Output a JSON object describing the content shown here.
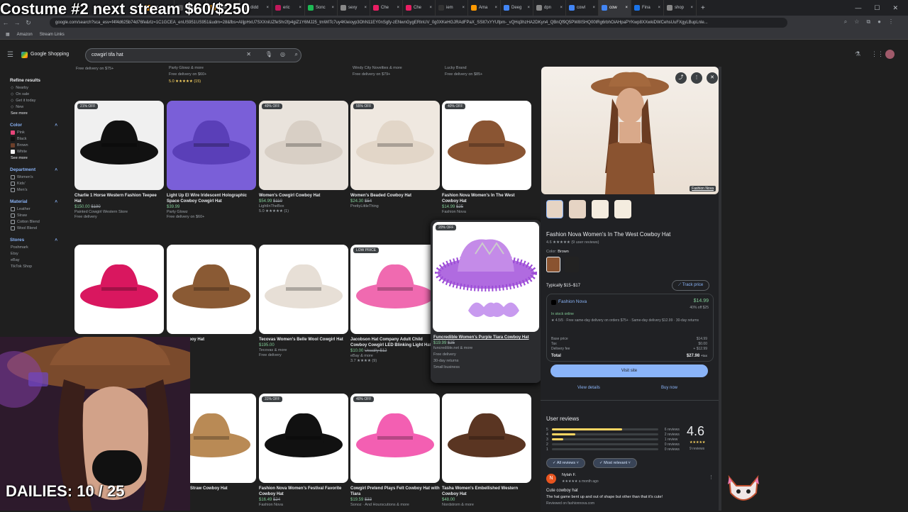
{
  "overlay": {
    "title": "Costume #2 next stream $60/$250",
    "dailies": "DAILIES: 10 / 25"
  },
  "browser": {
    "tabs": [
      "Ama",
      "didd",
      "Ama",
      "didd",
      "eric",
      "Sonc",
      "sexy",
      "Che",
      "Che",
      "iem",
      "Ama",
      "Deeg",
      "dpn",
      "cowl",
      "cow",
      "Fina",
      "shop"
    ],
    "active_tab": "cow",
    "url": "google.com/search?sca_esv=f4f4d625b74d76fe&rlz=1C1GCEA_enUS951US951&udm=28&fbs=AIljpHxU7SXXniUZfeShr2fp4giZ1Y6MJ25_tmWITc7uy4KIeioyp3OhN11EY0nSgfy-zENwnGygERInUV_0g0XKeHGJRAdFPaX_SSIt7xYYUfpm-_vQHq3hzHA2DKyn4_QBnQf9Q5PW8ISHQ00tRg6rbhOiAHpaPYKwp8XXwkiDWCehsUuFXgyLBupLnle...",
    "bookmarks": [
      "Amazon",
      "Stream Links"
    ]
  },
  "google": {
    "brand": "Google Shopping",
    "query": "cowgirl tifa hat"
  },
  "sidebar": {
    "refine": "Refine results",
    "refine_items": [
      "Nearby",
      "On sale",
      "Get it today",
      "New"
    ],
    "see_more": "See more",
    "color_h": "Color",
    "colors": [
      {
        "name": "Pink",
        "hex": "#e8457a"
      },
      {
        "name": "Black",
        "hex": "#111111"
      },
      {
        "name": "Brown",
        "hex": "#6b3f2a"
      },
      {
        "name": "White",
        "hex": "#f2f2f2"
      }
    ],
    "dept_h": "Department",
    "depts": [
      "Women's",
      "Kids'",
      "Men's"
    ],
    "material_h": "Material",
    "materials": [
      "Leather",
      "Straw",
      "Cotton Blend",
      "Wool Blend"
    ],
    "stores_h": "Stores",
    "stores": [
      "Poshmark",
      "Etsy",
      "eBay",
      "TikTok Shop"
    ]
  },
  "top_partial": [
    "Free delivery on $75+",
    "Party Glowz & more",
    "Free delivery on $60+",
    "5.0 ★★★★★ (15)",
    "Windy City Novelties & more",
    "Free delivery on $79+",
    "Lucky Brand",
    "Free delivery on $85+"
  ],
  "products_row1": [
    {
      "badge": "21% OFF",
      "title": "Charlie 1 Horse Western Fashion Teepee Hat",
      "price": "$150.00",
      "old": "$190",
      "store": "Painted Cowgirl Western Store",
      "extra": "Free delivery"
    },
    {
      "badge": "",
      "title": "Light Up El Wire Iridescent Holographic Space Cowboy Cowgirl Hat",
      "price": "$39.99",
      "old": "",
      "store": "Party Glowz",
      "extra": "Free delivery on $60+"
    },
    {
      "badge": "49% OFF",
      "title": "Women's Cowgirl Cowboy Hat",
      "price": "$54.99",
      "old": "$110",
      "store": "LightInTheBox",
      "extra": "5.0 ★★★★★ (1)"
    },
    {
      "badge": "55% OFF",
      "title": "Women's Beaded Cowboy Hat",
      "price": "$24.30",
      "old": "$54",
      "store": "PrettyLittleThing",
      "extra": ""
    },
    {
      "badge": "40% OFF",
      "title": "Fashion Nova Women's In The West Cowboy Hat",
      "price": "$14.99",
      "old": "$25",
      "store": "Fashion Nova",
      "extra": ""
    }
  ],
  "products_row2": [
    {
      "badge": "",
      "title": "",
      "price": "",
      "old": "",
      "store": "",
      "extra": ""
    },
    {
      "badge": "",
      "title": "...en's Cowboy Hat",
      "price": "",
      "old": "",
      "store": "...more",
      "extra": "★★★★ (2)"
    },
    {
      "badge": "",
      "title": "Tecovas Women's Belle Wool Cowgirl Hat",
      "price": "$195.00",
      "old": "",
      "store": "Tecovas & more",
      "extra": "Free delivery"
    },
    {
      "badge": "LOW PRICE",
      "title": "Jacobson Hat Company Adult Child Cowboy Cowgirl LED Blinking Light Hat",
      "price": "$10.00",
      "old": "Usually $12",
      "store": "eBay & more",
      "extra": "3.7 ★★★★ (9)"
    }
  ],
  "hover_card": {
    "badge": "20% OFF",
    "title": "Funcredible Women's Purple Tiara Cowboy Hat",
    "price": "$19.99",
    "old": "$25",
    "store": "funcredible.net & more",
    "l1": "Free delivery",
    "l2": "30-day returns",
    "l3": "Small business"
  },
  "products_row3": [
    {
      "badge": "",
      "title": "...Women's Straw Cowboy Hat",
      "price": "",
      "store": ""
    },
    {
      "badge": "31% OFF",
      "title": "Fashion Nova Women's Festival Favorite Cowboy Hat",
      "price": "$16.49",
      "old": "$24",
      "store": "Fashion Nova"
    },
    {
      "badge": "40% OFF",
      "title": "Cowgirl Pretend Plays Felt Cowboy Hat with Tiara",
      "price": "$19.59",
      "old": "$33",
      "store": "Sonoz · And Hourscutions & more"
    },
    {
      "badge": "",
      "title": "Tasha Women's Embellished Western Cowboy Hat",
      "price": "$48.00",
      "old": "",
      "store": "Nordstrom & more"
    }
  ],
  "panel": {
    "title": "Fashion Nova Women's In The West Cowboy Hat",
    "rating": "4.6 ★★★★★ (9 user reviews)",
    "color_label": "Color:",
    "color_value": "Brown",
    "typically": "Typically $15–$17",
    "track": "Track price",
    "image_credit": "Fashion Nova",
    "store": "Fashion Nova",
    "store_price": "$14.99",
    "store_discount": "40% off $25",
    "stock": "In stock online",
    "store_meta": "★ 4.5/5 · Free same-day delivery on orders $75+ · Same-day delivery $12.99 · 30-day returns",
    "breakdown": [
      {
        "k": "Base price",
        "v": "$14.99"
      },
      {
        "k": "Tax",
        "v": "$0.00"
      },
      {
        "k": "Delivery fee",
        "v": "+ $12.99"
      }
    ],
    "total_k": "Total",
    "total_v": "$27.98",
    "total_note": "+tax",
    "visit": "Visit site",
    "view_details": "View details",
    "buy_now": "Buy now",
    "reviews_h": "User reviews",
    "score": "4.6",
    "score_count": "9 reviews",
    "dist": [
      {
        "star": "5",
        "count": "6 reviews",
        "frac": 0.66
      },
      {
        "star": "4",
        "count": "2 reviews",
        "frac": 0.22
      },
      {
        "star": "3",
        "count": "1 review",
        "frac": 0.11
      },
      {
        "star": "2",
        "count": "0 reviews",
        "frac": 0
      },
      {
        "star": "1",
        "count": "0 reviews",
        "frac": 0
      }
    ],
    "filter1": "All reviews",
    "filter2": "Most relevant",
    "reviewer": "Nylah F.",
    "reviewer_meta": "★★★★★ a month ago",
    "review_title": "Cute cowboy hat",
    "review_body": "The hat game bent up and out of shape but other than that it's cute!",
    "review_src": "Reviewed on fashionnova.com"
  }
}
